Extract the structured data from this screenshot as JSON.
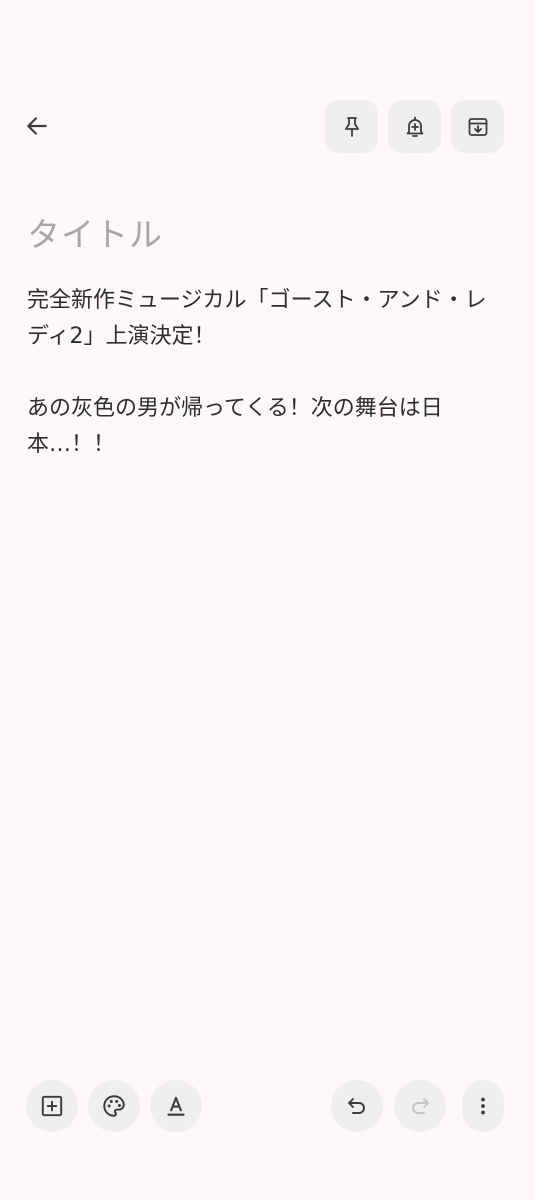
{
  "header": {
    "back_icon": "arrow-left-icon",
    "actions": [
      {
        "name": "pin",
        "icon": "pin-icon"
      },
      {
        "name": "reminder",
        "icon": "bell-plus-icon"
      },
      {
        "name": "archive",
        "icon": "archive-icon"
      }
    ]
  },
  "note": {
    "title_placeholder": "タイトル",
    "body_lines": [
      "完全新作ミュージカル「ゴースト・アンド・レ",
      "ディ2」上演決定！",
      "",
      "あの灰色の男が帰ってくる！次の舞台は日",
      "本…！！"
    ]
  },
  "footer": {
    "left_actions": [
      {
        "name": "add-content",
        "icon": "add-box-icon"
      },
      {
        "name": "background-color",
        "icon": "palette-icon"
      },
      {
        "name": "text-format",
        "icon": "text-format-icon"
      }
    ],
    "right_actions": [
      {
        "name": "undo",
        "icon": "undo-icon",
        "enabled": true
      },
      {
        "name": "redo",
        "icon": "redo-icon",
        "enabled": false
      },
      {
        "name": "more",
        "icon": "more-vertical-icon"
      }
    ]
  },
  "colors": {
    "background": "#fcf8f9",
    "chip": "#efedef",
    "icon": "#3d3b3e",
    "icon_disabled": "#c6c4c7",
    "placeholder": "#a7a5a8",
    "text": "#2d2c2e"
  }
}
